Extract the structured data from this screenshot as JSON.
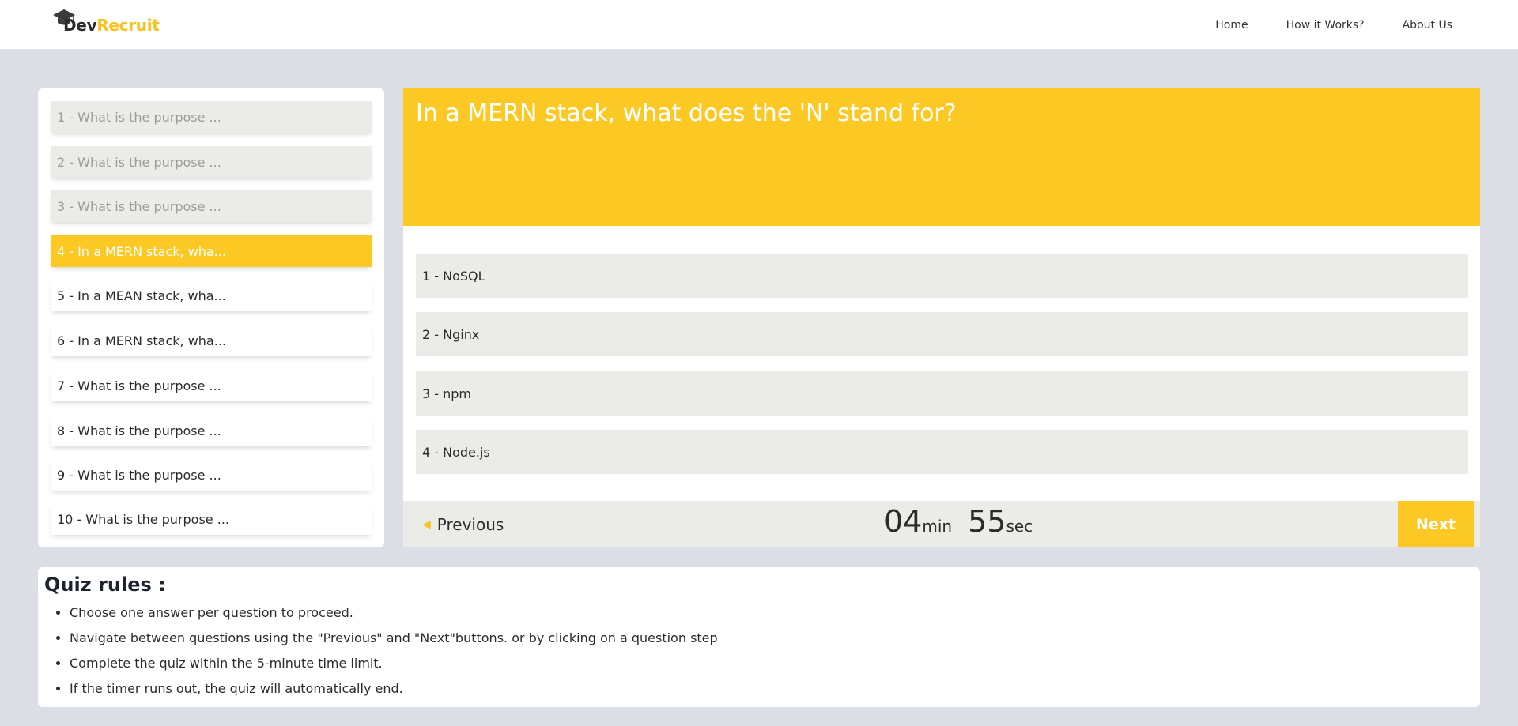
{
  "header": {
    "logo_dev": "Dev",
    "logo_recruit": "Recruit",
    "logo_icon": "graduation-cap-icon",
    "nav": [
      "Home",
      "How it Works?",
      "About Us"
    ]
  },
  "steps": [
    {
      "label": "1 - What is the purpose ...",
      "state": "done"
    },
    {
      "label": "2 - What is the purpose ...",
      "state": "done"
    },
    {
      "label": "3 - What is the purpose ...",
      "state": "done"
    },
    {
      "label": "4 - In a MERN stack, wha...",
      "state": "active"
    },
    {
      "label": "5 - In a MEAN stack, wha...",
      "state": "pending"
    },
    {
      "label": "6 - In a MERN stack, wha...",
      "state": "pending"
    },
    {
      "label": "7 - What is the purpose ...",
      "state": "pending"
    },
    {
      "label": "8 - What is the purpose ...",
      "state": "pending"
    },
    {
      "label": "9 - What is the purpose ...",
      "state": "pending"
    },
    {
      "label": "10 - What is the purpose ...",
      "state": "pending"
    }
  ],
  "question": {
    "text": "In a MERN stack, what does the 'N' stand for?",
    "answers": [
      "1 - NoSQL",
      "2 - Nginx",
      "3 - npm",
      "4 - Node.js"
    ]
  },
  "footer": {
    "previous_label": "Previous",
    "previous_icon": "caret-left-icon",
    "timer_min": "04",
    "timer_min_unit": "min",
    "timer_sec": "55",
    "timer_sec_unit": "sec",
    "next_label": "Next"
  },
  "rules": {
    "title": "Quiz rules :",
    "items": [
      "Choose one answer per question to proceed.",
      "Navigate between questions using the \"Previous\" and \"Next\"buttons. or by clicking on a question step",
      "Complete the quiz within the 5-minute time limit.",
      "If the timer runs out, the quiz will automatically end."
    ]
  },
  "colors": {
    "accent": "#fbc824",
    "background": "#dcdee5",
    "answer_bg": "#ebebe7"
  }
}
